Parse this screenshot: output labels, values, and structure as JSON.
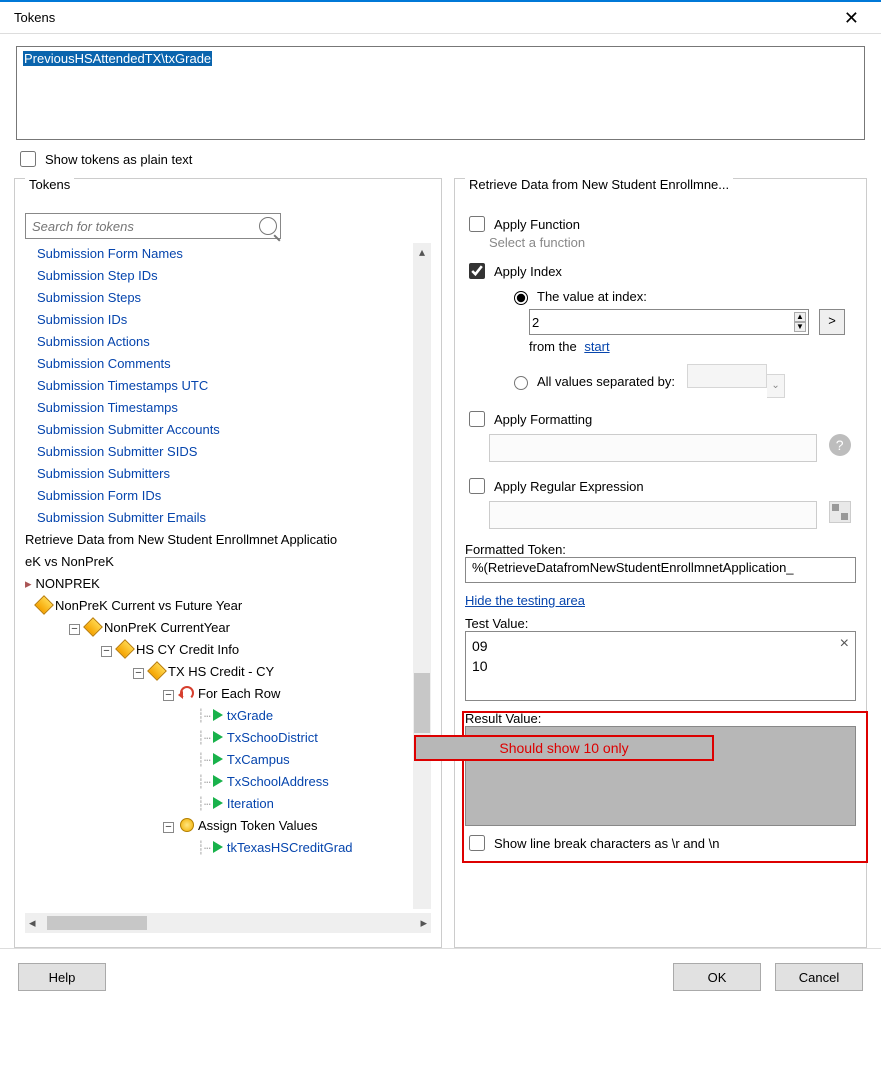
{
  "window": {
    "title": "Tokens"
  },
  "path_text": "PreviousHSAttendedTX\\txGrade",
  "show_plain": {
    "label": "Show tokens as plain text",
    "checked": false
  },
  "search": {
    "placeholder": "Search for tokens"
  },
  "tokens_group_title": "Tokens",
  "retrieve_group_title": "Retrieve Data from New Student Enrollmne...",
  "link_items": [
    "Submission Form Names",
    "Submission Step IDs",
    "Submission Steps",
    "Submission IDs",
    "Submission Actions",
    "Submission Comments",
    "Submission Timestamps UTC",
    "Submission Timestamps",
    "Submission Submitter Accounts",
    "Submission Submitter SIDS",
    "Submission Submitters",
    "Submission Form IDs",
    "Submission Submitter Emails"
  ],
  "tree_rows": [
    {
      "label": "Retrieve Data from New Student Enrollmnet Applicatio",
      "cls": "blklink indent-1"
    },
    {
      "label": "eK vs NonPreK",
      "cls": "blklink indent-1"
    },
    {
      "label": "NONPREK",
      "cls": "blklink indent-1",
      "rcaret": true
    },
    {
      "label": "NonPreK Current vs Future Year",
      "cls": "blklink indent-2",
      "diamond": true
    },
    {
      "label": "NonPreK CurrentYear",
      "cls": "blklink indent-3",
      "diamond": true,
      "minus": true
    },
    {
      "label": "HS CY Credit Info",
      "cls": "blklink indent-4",
      "diamond": true,
      "minus": true
    },
    {
      "label": "TX HS Credit - CY",
      "cls": "blklink indent-5",
      "diamond": true,
      "minus": true
    },
    {
      "label": "For Each Row",
      "cls": "blklink indent-6",
      "loop": true,
      "minus": true
    },
    {
      "label": "txGrade",
      "cls": "bluelink indent-7",
      "tri": true,
      "dots": true
    },
    {
      "label": "TxSchooDistrict",
      "cls": "bluelink indent-7",
      "tri": true,
      "dots": true
    },
    {
      "label": "TxCampus",
      "cls": "bluelink indent-7",
      "tri": true,
      "dots": true
    },
    {
      "label": "TxSchoolAddress",
      "cls": "bluelink indent-7",
      "tri": true,
      "dots": true
    },
    {
      "label": "Iteration",
      "cls": "bluelink indent-7",
      "tri": true,
      "dots": true
    },
    {
      "label": "Assign Token Values",
      "cls": "blklink indent-6",
      "coin": true,
      "minus": true
    },
    {
      "label": "tkTexasHSCreditGrad",
      "cls": "bluelink indent-7",
      "tri": true,
      "dots": true,
      "truncated": true
    }
  ],
  "apply_function": {
    "label": "Apply Function",
    "hint": "Select a function",
    "checked": false
  },
  "apply_index": {
    "label": "Apply Index",
    "checked": true,
    "opt_value_at": "The value at index:",
    "index_value": "2",
    "from_the": "from the",
    "start": "start",
    "opt_all_sep": "All values separated by:"
  },
  "apply_formatting": {
    "label": "Apply Formatting",
    "checked": false
  },
  "apply_regex": {
    "label": "Apply Regular Expression",
    "checked": false
  },
  "formatted_token": {
    "label": "Formatted Token:",
    "value": "%(RetrieveDatafromNewStudentEnrollmnetApplication_"
  },
  "hide_testing": "Hide the testing area",
  "test_value": {
    "label": "Test Value:",
    "line1": "09",
    "line2": "10"
  },
  "result": {
    "label": "Result Value:",
    "callout": "Should show 10 only"
  },
  "show_lb": "Show line break characters as \\r and \\n",
  "buttons": {
    "help": "Help",
    "ok": "OK",
    "cancel": "Cancel"
  }
}
